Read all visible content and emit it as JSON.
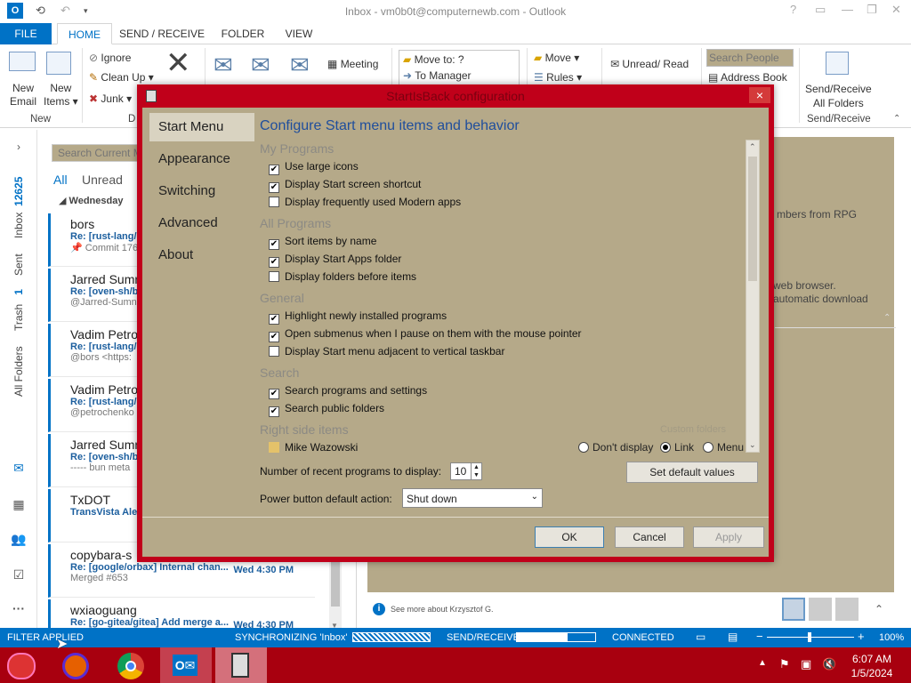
{
  "window": {
    "title": "Inbox - vm0b0t@computernewb.com - Outlook"
  },
  "tabs": [
    "FILE",
    "HOME",
    "SEND / RECEIVE",
    "FOLDER",
    "VIEW"
  ],
  "ribbon": {
    "new_email": [
      "New",
      "Email"
    ],
    "new_items": [
      "New",
      "Items"
    ],
    "group_new": "New",
    "ignore": "Ignore",
    "clean_up": "Clean Up",
    "junk": "Junk",
    "group_delete_partial": "D",
    "meeting": "Meeting",
    "move_to": "Move to: ?",
    "to_manager": "To Manager",
    "move": "Move",
    "rules": "Rules",
    "unread_read": "Unread/ Read",
    "search_people": "Search People",
    "address_book": "Address Book",
    "send_receive_all": [
      "Send/Receive",
      "All Folders"
    ],
    "group_send_receive": "Send/Receive"
  },
  "leftnav": {
    "inbox": "Inbox",
    "inbox_count": "12625",
    "sent": "Sent",
    "trash": "Trash",
    "trash_count": "1",
    "all_folders": "All Folders"
  },
  "maillist": {
    "search_placeholder": "Search Current M",
    "filter_all": "All",
    "filter_unread": "Unread",
    "group_header": "Wednesday",
    "items": [
      {
        "sender": "bors",
        "subject": "Re: [rust-lang/",
        "preview": "Commit 176",
        "time": ""
      },
      {
        "sender": "Jarred Sumn",
        "subject": "Re: [oven-sh/b",
        "preview": "@Jarred-Sumn",
        "time": ""
      },
      {
        "sender": "Vadim Petro",
        "subject": "Re: [rust-lang/",
        "preview": "@bors <https:",
        "time": ""
      },
      {
        "sender": "Vadim Petro",
        "subject": "Re: [rust-lang/",
        "preview": "@petrochenko",
        "time": ""
      },
      {
        "sender": "Jarred Sumn",
        "subject": "Re: [oven-sh/b",
        "preview": "----- bun meta",
        "time": ""
      },
      {
        "sender": "TxDOT",
        "subject": "TransVista Ale",
        "preview": "",
        "time": ""
      },
      {
        "sender": "copybara-s",
        "subject": "Re: [google/orbax] Internal chan...",
        "preview": "Merged #653",
        "time": "Wed 4:30 PM"
      },
      {
        "sender": "wxiaoguang",
        "subject": "Re: [go-gitea/gitea] Add merge a...",
        "preview": "",
        "time": "Wed 4:30 PM"
      }
    ]
  },
  "reading": {
    "text1": "mbers from RPG",
    "text2": "web browser.",
    "text3": "automatic download",
    "footer": "See more about Krzysztof G."
  },
  "dialog": {
    "title": "StartIsBack configuration",
    "close": "×",
    "sidebar": [
      "Start Menu",
      "Appearance",
      "Switching",
      "Advanced",
      "About"
    ],
    "heading": "Configure Start menu items and behavior",
    "sections": {
      "my_programs": "My Programs",
      "all_programs": "All Programs",
      "general": "General",
      "search": "Search",
      "right_side": "Right side items",
      "custom_folders": "Custom folders"
    },
    "options": [
      {
        "label": "Use large icons",
        "checked": true
      },
      {
        "label": "Display Start screen shortcut",
        "checked": true
      },
      {
        "label": "Display frequently used Modern apps",
        "checked": false
      },
      {
        "label": "Sort items by name",
        "checked": true
      },
      {
        "label": "Display Start Apps folder",
        "checked": true
      },
      {
        "label": "Display folders before items",
        "checked": false
      },
      {
        "label": "Highlight newly installed programs",
        "checked": true
      },
      {
        "label": "Open submenus when I pause on them with the mouse pointer",
        "checked": true
      },
      {
        "label": "Display Start menu adjacent to vertical taskbar",
        "checked": false
      },
      {
        "label": "Search programs and settings",
        "checked": true
      },
      {
        "label": "Search public folders",
        "checked": true
      }
    ],
    "right_item": "Mike Wazowski",
    "radio": [
      "Don't display",
      "Link",
      "Menu"
    ],
    "radio_selected": "Link",
    "recent_label": "Number of recent programs to display:",
    "recent_value": "10",
    "set_default": "Set default values",
    "power_label": "Power button default action:",
    "power_value": "Shut down",
    "ok": "OK",
    "cancel": "Cancel",
    "apply": "Apply"
  },
  "statusbar": {
    "filter": "FILTER APPLIED",
    "sync": "SYNCHRONIZING  'Inbox'",
    "send_receive": "SEND/RECEIVE",
    "connected": "CONNECTED",
    "zoom": "100%"
  },
  "taskbar": {
    "time": "6:07 AM",
    "date": "1/5/2024"
  },
  "colors": {
    "accent": "#0072c6",
    "dialog_frame": "#c0001a",
    "dialog_bg": "#b5a989",
    "taskbar": "#a8000f"
  }
}
